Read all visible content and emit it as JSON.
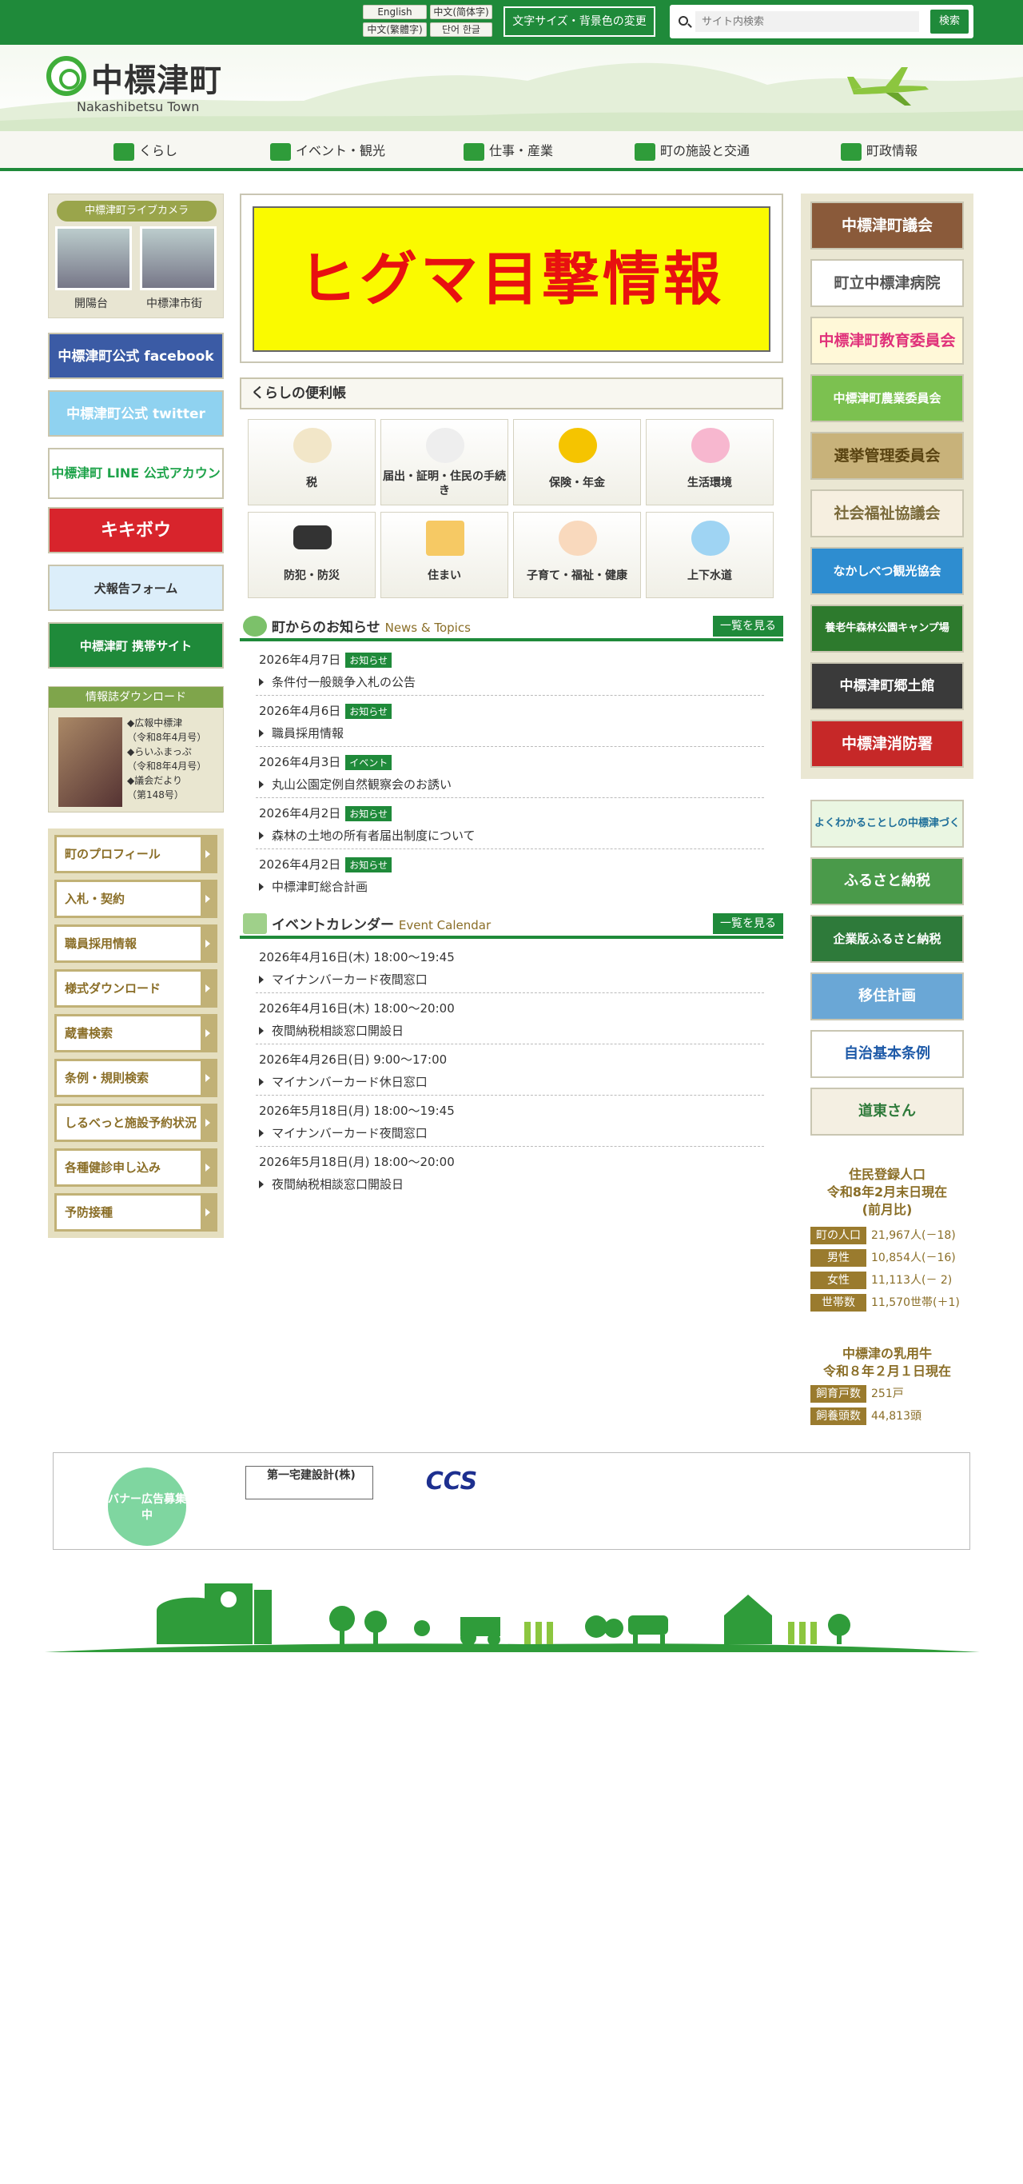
{
  "topbar": {
    "lang_en": "English",
    "lang_zh_s": "中文(简体字)",
    "lang_zh_t": "中文(繁體字)",
    "lang_ko": "단어 한글",
    "font_button": "文字サイズ・背景色の変更",
    "search_placeholder": "サイト内検索",
    "search_button": "検索"
  },
  "header": {
    "title": "中標津町",
    "subtitle": "Nakashibetsu Town"
  },
  "nav": [
    {
      "label": "くらし"
    },
    {
      "label": "イベント・観光"
    },
    {
      "label": "仕事・産業"
    },
    {
      "label": "町の施設と交通"
    },
    {
      "label": "町政情報"
    }
  ],
  "left": {
    "livecam_title": "中標津町ライブカメラ",
    "cam1_label": "開陽台",
    "cam2_label": "中標津市街",
    "banners": [
      "中標津町公式 facebook",
      "中標津町公式 twitter",
      "中標津町 LINE 公式アカウント",
      "キキボウ",
      "犬報告フォーム",
      "中標津町 携帯サイト"
    ],
    "download_title": "情報誌ダウンロード",
    "download_lines": [
      "◆広報中標津",
      "（令和8年4月号）",
      "◆らいふまっぷ",
      "（令和8年4月号）",
      "◆議会だより",
      "（第148号）"
    ],
    "menu": [
      "町のプロフィール",
      "入札・契約",
      "職員採用情報",
      "様式ダウンロード",
      "蔵書検索",
      "条例・規則検索",
      "しるべっと施設予約状況",
      "各種健診申し込み",
      "予防接種"
    ]
  },
  "main": {
    "slider_text": "ヒグマ目撃情報",
    "kurashi_title": "くらしの便利帳",
    "cards": [
      "税",
      "届出・証明・住民の手続き",
      "保険・年金",
      "生活環境",
      "防犯・防災",
      "住まい",
      "子育て・福祉・健康",
      "上下水道"
    ],
    "news_title": "町からのお知らせ",
    "news_en": "News & Topics",
    "more_label": "一覧を見る",
    "news": [
      {
        "date": "2026年4月7日",
        "tag": "お知らせ",
        "title": "条件付一般競争入札の公告"
      },
      {
        "date": "2026年4月6日",
        "tag": "お知らせ",
        "title": "職員採用情報"
      },
      {
        "date": "2026年4月3日",
        "tag": "イベント",
        "title": "丸山公園定例自然観察会のお誘い"
      },
      {
        "date": "2026年4月2日",
        "tag": "お知らせ",
        "title": "森林の土地の所有者届出制度について"
      },
      {
        "date": "2026年4月2日",
        "tag": "お知らせ",
        "title": "中標津町総合計画"
      }
    ],
    "event_title": "イベントカレンダー",
    "event_en": "Event Calendar",
    "events": [
      {
        "date": "2026年4月16日(木) 18:00～19:45",
        "title": "マイナンバーカード夜間窓口"
      },
      {
        "date": "2026年4月16日(木) 18:00～20:00",
        "title": "夜間納税相談窓口開設日"
      },
      {
        "date": "2026年4月26日(日) 9:00～17:00",
        "title": "マイナンバーカード休日窓口"
      },
      {
        "date": "2026年5月18日(月) 18:00～19:45",
        "title": "マイナンバーカード夜間窓口"
      },
      {
        "date": "2026年5月18日(月) 18:00～20:00",
        "title": "夜間納税相談窓口開設日"
      }
    ]
  },
  "right": {
    "links": [
      "中標津町議会",
      "町立中標津病院",
      "中標津町教育委員会",
      "中標津町農業委員会",
      "選挙管理委員会",
      "社会福祉協議会",
      "なかしべつ観光協会",
      "養老牛森林公園キャンプ場",
      "中標津町郷土館",
      "中標津消防署"
    ],
    "links2": [
      "よくわかることしの中標津づくり",
      "ふるさと納税",
      "企業版ふるさと納税",
      "移住計画",
      "自治基本条例",
      "道東さん"
    ],
    "pop_title1": "住民登録人口",
    "pop_title2": "令和8年2月末日現在",
    "pop_title3": "(前月比)",
    "pop_rows": [
      {
        "k": "町の人口",
        "v": "21,967人(－18)"
      },
      {
        "k": "男性",
        "v": "10,854人(－16)"
      },
      {
        "k": "女性",
        "v": "11,113人(－ 2)"
      },
      {
        "k": "世帯数",
        "v": "11,570世帯(＋1)"
      }
    ],
    "cow_title1": "中標津の乳用牛",
    "cow_title2": "令和８年２月１日現在",
    "cow_rows": [
      {
        "k": "飼育戸数",
        "v": "251戸"
      },
      {
        "k": "飼養頭数",
        "v": "44,813頭"
      }
    ]
  },
  "ads": {
    "circle": "バナー広告募集中",
    "ad1": "第一宅建設計(株)",
    "ad2": "CCS"
  },
  "colors": {
    "brand_green": "#1f8a3a",
    "gold": "#9a7b2e",
    "alert_red": "#e81010",
    "alert_yellow": "#fafa00"
  }
}
